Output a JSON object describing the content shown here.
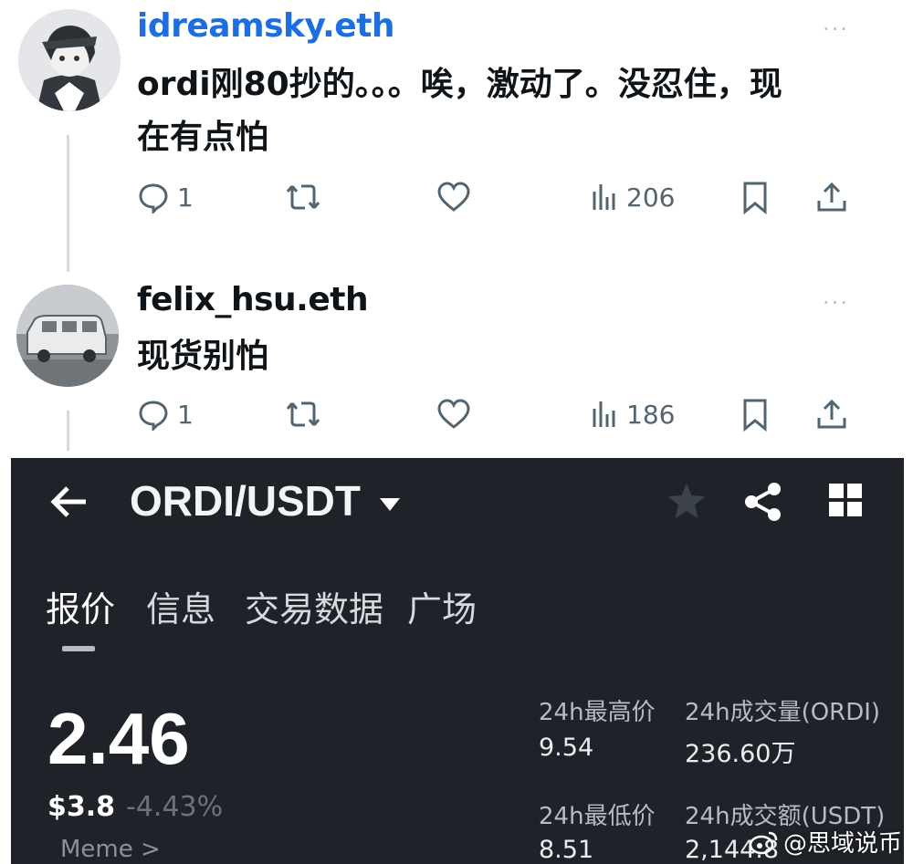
{
  "tweets": [
    {
      "username": "idreamsky.eth",
      "text_line1": "ordi刚80抄的。。。唉，激动了。没忍住，现",
      "text_line2": "在有点怕",
      "more": "···",
      "replies": "1",
      "views": "206",
      "username_color": "#1d6fe0"
    },
    {
      "username": "felix_hsu.eth",
      "text_line1": "现货别怕",
      "more": "···",
      "replies": "1",
      "views": "186",
      "username_color": "#0f1419"
    }
  ],
  "exchange": {
    "pair": "ORDI/USDT",
    "tabs": [
      "报价",
      "信息",
      "交易数据",
      "广场"
    ],
    "active_tab": "报价",
    "price": "2.46",
    "usd_price": "$3.8",
    "change": "-4.43%",
    "tag": "Meme >",
    "stats": {
      "high_label": "24h最高价",
      "high_value": "9.54",
      "vol_ordi_label": "24h成交量(ORDI)",
      "vol_ordi_value": "236.60万",
      "low_label": "24h最低价",
      "low_value": "8.51",
      "vol_usdt_label": "24h成交额(USDT)",
      "vol_usdt_value": "2,144.8"
    }
  },
  "watermark": "@思域说币",
  "icons": [
    "back-arrow-icon",
    "caret-down-icon",
    "star-icon",
    "share-icon",
    "grid-icon",
    "reply-icon",
    "retweet-icon",
    "like-icon",
    "views-icon",
    "bookmark-icon",
    "upload-icon",
    "weibo-icon"
  ]
}
